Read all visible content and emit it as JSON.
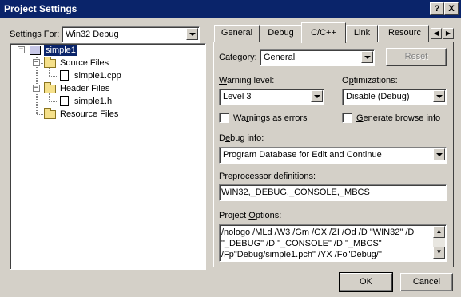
{
  "window": {
    "title": "Project Settings"
  },
  "title_buttons": {
    "help": "?",
    "close": "X"
  },
  "settings_for": {
    "label_underline": "S",
    "label_rest": "ettings For:",
    "value": "Win32 Debug"
  },
  "tree": {
    "root": "simple1",
    "source_files": "Source Files",
    "source_file_1": "simple1.cpp",
    "header_files": "Header Files",
    "header_file_1": "simple1.h",
    "resource_files": "Resource Files"
  },
  "tabs": [
    "General",
    "Debug",
    "C/C++",
    "Link",
    "Resourc"
  ],
  "active_tab": "C/C++",
  "category": {
    "label_pre": "Categ",
    "label_underline": "o",
    "label_post": "ry:",
    "value": "General",
    "reset_label": "Reset"
  },
  "warning_level": {
    "label_pre": "",
    "label_underline": "W",
    "label_post": "arning level:",
    "value": "Level 3"
  },
  "optimizations": {
    "label_pre": "O",
    "label_underline": "p",
    "label_post": "timizations:",
    "value": "Disable (Debug)"
  },
  "warnings_as_errors": {
    "label_pre": "Wa",
    "label_underline": "r",
    "label_post": "nings as errors",
    "checked": false
  },
  "generate_browse_info": {
    "label_pre": "",
    "label_underline": "G",
    "label_post": "enerate browse info",
    "checked": false
  },
  "debug_info": {
    "label_pre": "D",
    "label_underline": "e",
    "label_post": "bug info:",
    "value": "Program Database for Edit and Continue"
  },
  "preprocessor": {
    "label_pre": "Preprocessor ",
    "label_underline": "d",
    "label_post": "efinitions:",
    "value": "WIN32,_DEBUG,_CONSOLE,_MBCS"
  },
  "project_options": {
    "label_pre": "Project ",
    "label_underline": "O",
    "label_post": "ptions:",
    "lines": [
      "/nologo /MLd /W3 /Gm /GX /ZI /Od /D \"WIN32\" /D",
      "\"_DEBUG\" /D \"_CONSOLE\" /D \"_MBCS\"",
      "/Fp\"Debug/simple1.pch\" /YX /Fo\"Debug/\""
    ]
  },
  "buttons": {
    "ok": "OK",
    "cancel": "Cancel"
  },
  "colors": {
    "titlebar": "#0a246a",
    "selection": "#0a246a",
    "face": "#d4d0c8"
  }
}
